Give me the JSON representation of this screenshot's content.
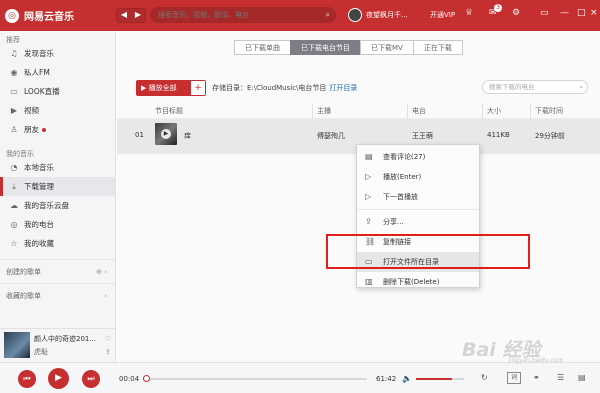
{
  "app": {
    "title": "网易云音乐",
    "logo_glyph": "◎",
    "accent": "#c62f2f"
  },
  "titlebar": {
    "search_placeholder": "搜索音乐，视频，歌词，电台",
    "username": "夜望枫月千...",
    "vip": "开通VIP",
    "badge": "3",
    "icons": [
      "search-icon",
      "shirt-icon",
      "mail-icon",
      "gear-icon",
      "minimize-icon",
      "maximize-icon",
      "close-icon"
    ],
    "nav": {
      "back": "◀",
      "forward": "▶"
    }
  },
  "sidebar": {
    "recommend_head": "推荐",
    "recommend": [
      {
        "label": "发现音乐",
        "icon": "♫"
      },
      {
        "label": "私人FM",
        "icon": "◉"
      },
      {
        "label": "LOOK直播",
        "icon": "▭"
      },
      {
        "label": "视频",
        "icon": "▶"
      },
      {
        "label": "朋友",
        "icon": "♙"
      }
    ],
    "mymusic_head": "我的音乐",
    "mymusic": [
      {
        "label": "本地音乐",
        "icon": "◔"
      },
      {
        "label": "下载管理",
        "icon": "⤓"
      },
      {
        "label": "我的音乐云盘",
        "icon": "☁"
      },
      {
        "label": "我的电台",
        "icon": "◎"
      },
      {
        "label": "我的收藏",
        "icon": "☆"
      }
    ],
    "created": "创建的歌单",
    "collected": "收藏的歌单"
  },
  "now_playing": {
    "title": "颜人中的奇迹201...",
    "artist": "虎耻"
  },
  "tabs": [
    "已下载单曲",
    "已下载电台节目",
    "已下载MV",
    "正在下载"
  ],
  "toolbar": {
    "play_all": "播放全部",
    "plus": "+",
    "store_label": "存储目录：E:\\CloudMusic\\电台节目",
    "open_dir": "打开目录",
    "search_placeholder": "搜索下载的电台"
  },
  "table": {
    "headers": [
      "节目标题",
      "主播",
      "电台",
      "大小",
      "下载时间"
    ],
    "rows": [
      {
        "index": "01",
        "title": "痒",
        "host": "傅瑟殉几",
        "station": "王王萌",
        "size": "411KB",
        "time": "29分钟前"
      }
    ]
  },
  "context_menu": {
    "items": [
      {
        "label": "查看评论(27)",
        "icon": "▤"
      },
      {
        "label": "播放(Enter)",
        "icon": "▷"
      },
      {
        "label": "下一首播放",
        "icon": "▷"
      },
      {
        "label": "分享...",
        "icon": "⇪"
      },
      {
        "label": "复制链接",
        "icon": "⛓"
      },
      {
        "label": "打开文件所在目录",
        "icon": "▭"
      },
      {
        "label": "删除下载(Delete)",
        "icon": "▥"
      }
    ]
  },
  "player": {
    "current_time": "00:04",
    "total_time": "61:42",
    "progress": 0.012,
    "volume": 0.75,
    "lyric": "词",
    "watermark": "Bai 经验",
    "watermark_url": "jingyan.baidu.com"
  }
}
